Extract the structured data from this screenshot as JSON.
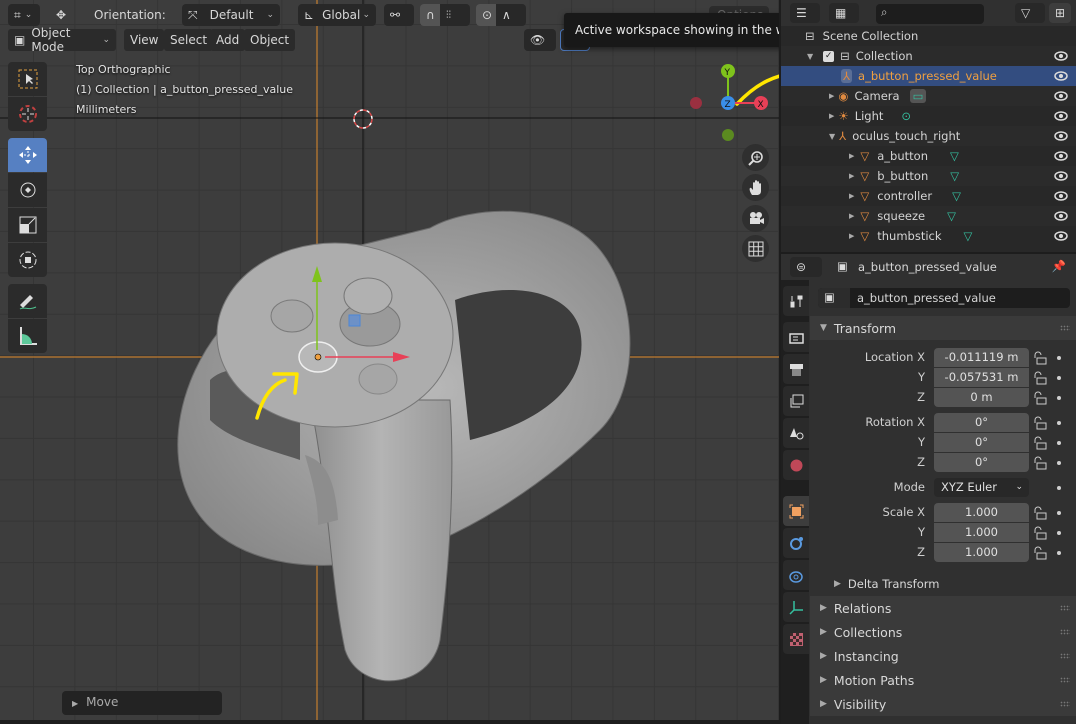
{
  "header": {
    "orientation_label": "Orientation:",
    "orientation_value": "Default",
    "transform_space": "Global",
    "options_label": "Options",
    "tooltip": "Active workspace showing in the window."
  },
  "menu": {
    "mode": "Object Mode",
    "items": [
      "View",
      "Select",
      "Add",
      "Object"
    ]
  },
  "toolbar": {
    "tools": [
      "select-box",
      "cursor",
      "move",
      "rotate",
      "scale",
      "transform",
      "annotate",
      "measure"
    ],
    "active_tool": "move"
  },
  "viewport": {
    "view_name": "Top Orthographic",
    "collection_info": "(1) Collection | a_button_pressed_value",
    "units": "Millimeters",
    "gizmo": {
      "x": "X",
      "y": "Y",
      "z": "Z"
    },
    "last_operator": "Move",
    "colors": {
      "x_axis": "#e84057",
      "y_axis": "#7fc31c",
      "z_axis": "#3a8fe8",
      "selection": "#f0a040",
      "annotation": "#ffe600"
    }
  },
  "outliner": {
    "scene_collection": "Scene Collection",
    "rows": [
      {
        "name": "Collection",
        "type": "collection",
        "indent": 0
      },
      {
        "name": "a_button_pressed_value",
        "type": "empty",
        "indent": 1,
        "selected": true
      },
      {
        "name": "Camera",
        "type": "camera",
        "indent": 1
      },
      {
        "name": "Light",
        "type": "light",
        "indent": 1
      },
      {
        "name": "oculus_touch_right",
        "type": "empty",
        "indent": 1
      },
      {
        "name": "a_button",
        "type": "mesh",
        "indent": 2
      },
      {
        "name": "b_button",
        "type": "mesh",
        "indent": 2
      },
      {
        "name": "controller",
        "type": "mesh",
        "indent": 2
      },
      {
        "name": "squeeze",
        "type": "mesh",
        "indent": 2
      },
      {
        "name": "thumbstick",
        "type": "mesh",
        "indent": 2
      }
    ]
  },
  "properties": {
    "context_object": "a_button_pressed_value",
    "object_name": "a_button_pressed_value",
    "transform_title": "Transform",
    "location": {
      "label": "Location X",
      "x": "-0.011119 m",
      "y": "-0.057531 m",
      "z": "0 m"
    },
    "rotation": {
      "label": "Rotation X",
      "x": "0°",
      "y": "0°",
      "z": "0°"
    },
    "mode_label": "Mode",
    "mode_value": "XYZ Euler",
    "scale": {
      "label": "Scale X",
      "x": "1.000",
      "y": "1.000",
      "z": "1.000"
    },
    "axis_labels": {
      "y": "Y",
      "z": "Z"
    },
    "delta_transform": "Delta Transform",
    "panels": [
      "Relations",
      "Collections",
      "Instancing",
      "Motion Paths",
      "Visibility"
    ]
  }
}
